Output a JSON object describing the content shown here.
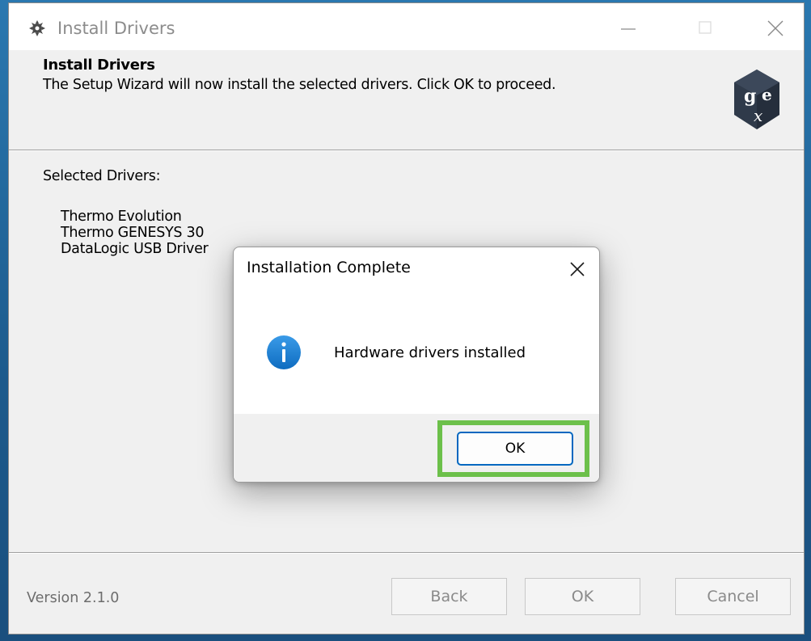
{
  "main_window": {
    "title": "Install Drivers",
    "header": {
      "title": "Install Drivers",
      "subtitle": "The Setup Wizard will now install the selected drivers. Click OK to proceed."
    },
    "selected_label": "Selected Drivers:",
    "drivers": [
      "Thermo Evolution",
      "Thermo GENESYS 30",
      "DataLogic USB Driver"
    ],
    "version": "Version 2.1.0",
    "buttons": {
      "back": "Back",
      "ok": "OK",
      "cancel": "Cancel"
    },
    "icons": {
      "app": "gear-shield-icon",
      "logo": "gex-cube-logo-icon"
    }
  },
  "dialog": {
    "title": "Installation Complete",
    "message": "Hardware drivers installed",
    "ok_label": "OK",
    "icon": "info-icon"
  },
  "colors": {
    "accent": "#0067c0",
    "highlight": "#6cc04a",
    "info": "#1a83d6",
    "logo_dark": "#2f3a4a"
  }
}
